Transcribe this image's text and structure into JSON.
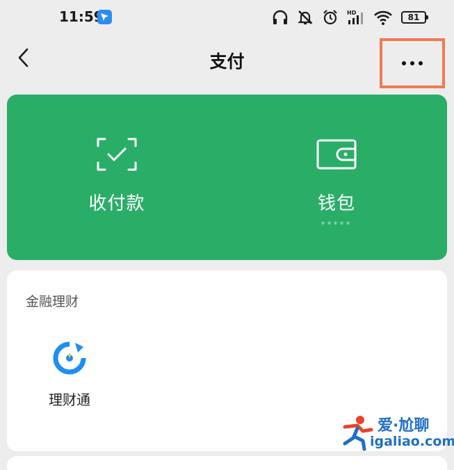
{
  "status_bar": {
    "time": "11:59",
    "battery": "81"
  },
  "nav": {
    "title": "支付"
  },
  "pay_card": {
    "items": [
      {
        "label": "收付款",
        "icon": "scan-check-icon"
      },
      {
        "label": "钱包",
        "icon": "wallet-icon",
        "mask": "*****"
      }
    ],
    "color": "#2aae67"
  },
  "finance": {
    "title": "金融理财",
    "items": [
      {
        "label": "理财通",
        "icon": "licaitong-icon"
      }
    ]
  },
  "watermark": {
    "top": "爱·尬聊",
    "bottom": "igaliao.com"
  },
  "colors": {
    "background": "#ededed",
    "highlight": "#ef7b4f",
    "watermark": "#1f6fc6"
  }
}
